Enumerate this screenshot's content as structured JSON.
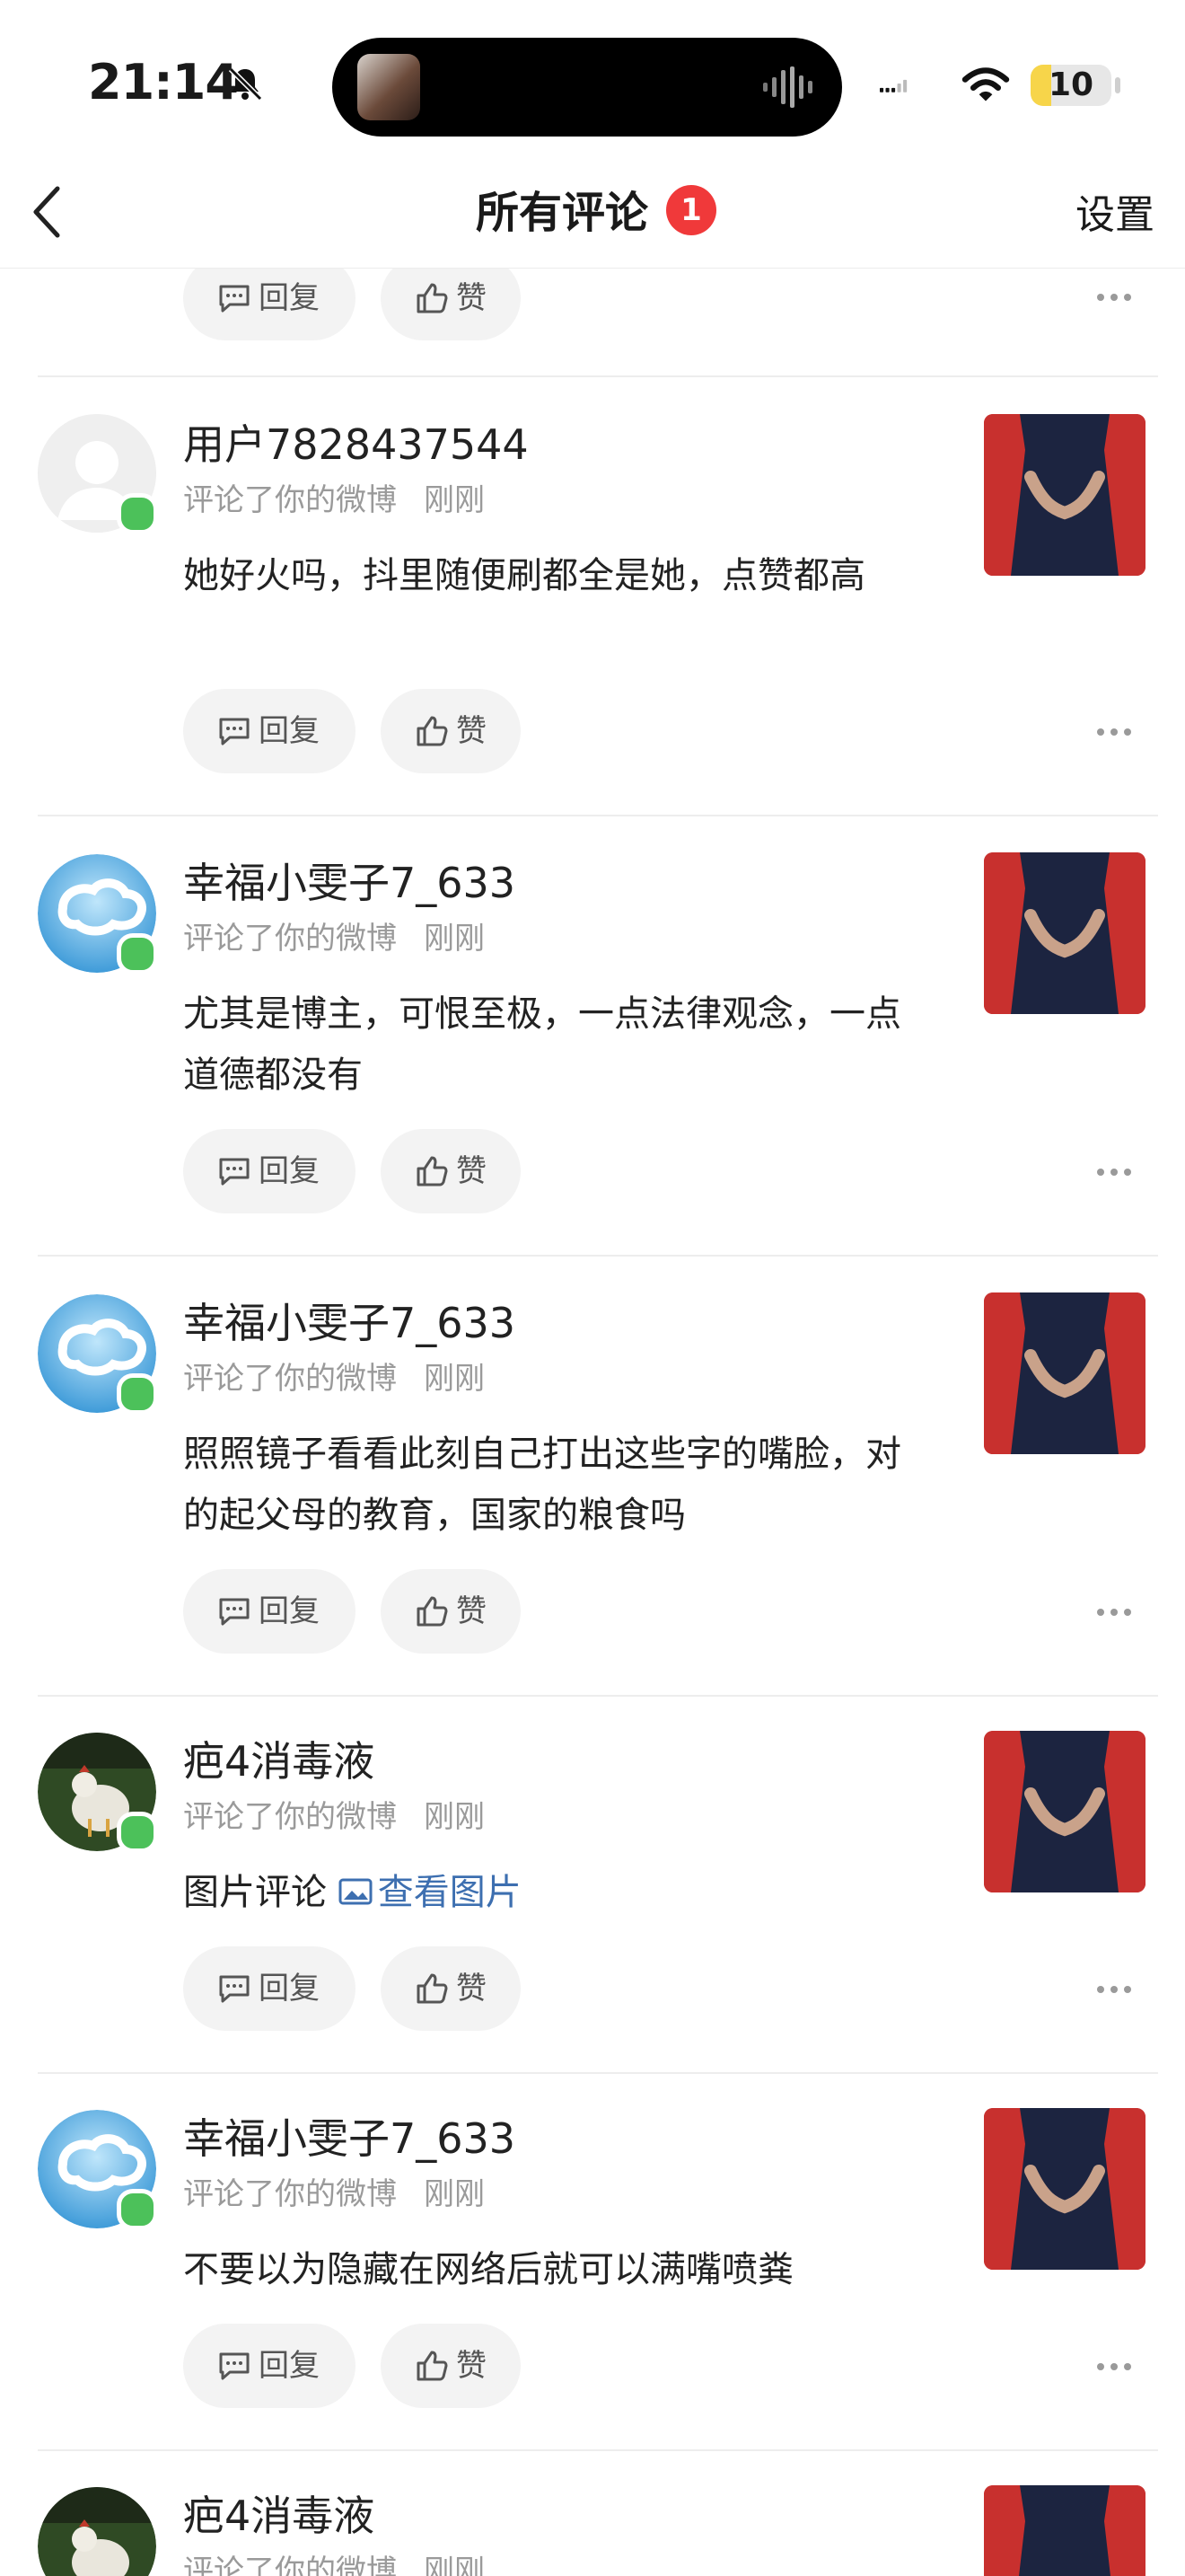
{
  "status_bar": {
    "time": "21:14",
    "battery": "10",
    "battery_percent": 10
  },
  "header": {
    "title": "所有评论",
    "badge_count": "1",
    "settings_label": "设置"
  },
  "actions": {
    "reply_label": "回复",
    "like_label": "赞"
  },
  "comments": [
    {
      "username": "用户7828437544",
      "action": "评论了你的微博",
      "time": "刚刚",
      "text": "她好火吗，抖里随便刷都全是她，点赞都高",
      "avatar": "default-user-avatar"
    },
    {
      "username": "幸福小雯子7_633",
      "action": "评论了你的微博",
      "time": "刚刚",
      "text": "尤其是博主，可恨至极，一点法律观念，一点道德都没有",
      "avatar": "cloud-avatar"
    },
    {
      "username": "幸福小雯子7_633",
      "action": "评论了你的微博",
      "time": "刚刚",
      "text": "照照镜子看看此刻自己打出这些字的嘴脸，对的起父母的教育，国家的粮食吗",
      "avatar": "cloud-avatar"
    },
    {
      "username": "疤4消毒液",
      "action": "评论了你的微博",
      "time": "刚刚",
      "text": "图片评论",
      "link": "查看图片",
      "avatar": "chicken-avatar"
    },
    {
      "username": "幸福小雯子7_633",
      "action": "评论了你的微博",
      "time": "刚刚",
      "text": "不要以为隐藏在网络后就可以满嘴喷粪",
      "avatar": "cloud-avatar"
    },
    {
      "username": "疤4消毒液",
      "action": "评论了你的微博",
      "time": "刚刚",
      "avatar": "chicken-avatar"
    }
  ],
  "colors": {
    "badge": "#f0393a",
    "online": "#4cc15a",
    "link": "#3d6fb0",
    "pill_bg": "#f3f3f3"
  }
}
